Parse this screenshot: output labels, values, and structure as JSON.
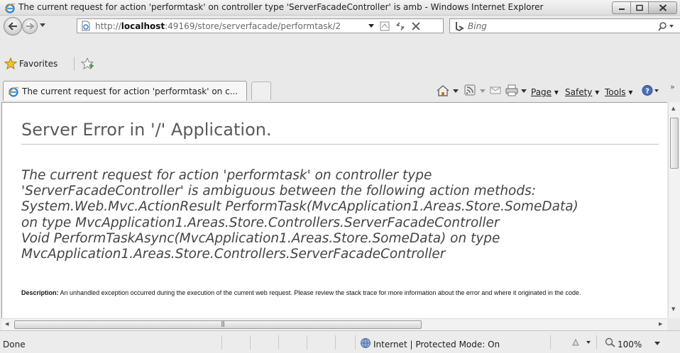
{
  "window": {
    "title": "The current request for action 'performtask' on controller type 'ServerFacadeController' is amb - Windows Internet Explorer"
  },
  "address_bar": {
    "url_prefix": "http://",
    "url_host": "localhost",
    "url_rest": ":49169/store/serverfacade/performtask/2"
  },
  "search": {
    "placeholder": "Bing"
  },
  "favorites_bar": {
    "favorites_label": "Favorites"
  },
  "tab": {
    "title": "The current request for action 'performtask' on c..."
  },
  "command_bar": {
    "page_label": "Page",
    "safety_label": "Safety",
    "tools_label": "Tools"
  },
  "page": {
    "heading": "Server Error in '/' Application.",
    "error_lines": [
      "The current request for action 'performtask' on controller type",
      "'ServerFacadeController' is ambiguous between the following action methods:",
      "System.Web.Mvc.ActionResult PerformTask(MvcApplication1.Areas.Store.SomeData)",
      "on type MvcApplication1.Areas.Store.Controllers.ServerFacadeController",
      "Void PerformTaskAsync(MvcApplication1.Areas.Store.SomeData) on type",
      "MvcApplication1.Areas.Store.Controllers.ServerFacadeController"
    ],
    "description_label": "Description:",
    "description_text": "An unhandled exception occurred during the execution of the current web request. Please review the stack trace for more information about the error and where it originated in the code."
  },
  "status_bar": {
    "status_text": "Done",
    "zone_text": "Internet | Protected Mode: On",
    "zoom_text": "100%"
  },
  "colors": {
    "chrome_background": "#e9e9e9",
    "heading_gray": "#5a5a5a",
    "error_text": "#444444",
    "ie_blue": "#2a7fd4"
  },
  "icons": [
    "ie-logo-icon",
    "minimize-icon",
    "maximize-icon",
    "close-icon",
    "back-icon",
    "forward-icon",
    "page-icon",
    "compatibility-view-icon",
    "refresh-icon",
    "stop-icon",
    "bing-icon",
    "search-icon",
    "favorites-star-icon",
    "add-favorites-icon",
    "home-icon",
    "feeds-icon",
    "read-mail-icon",
    "print-icon",
    "help-icon",
    "globe-icon",
    "zoom-icon"
  ]
}
